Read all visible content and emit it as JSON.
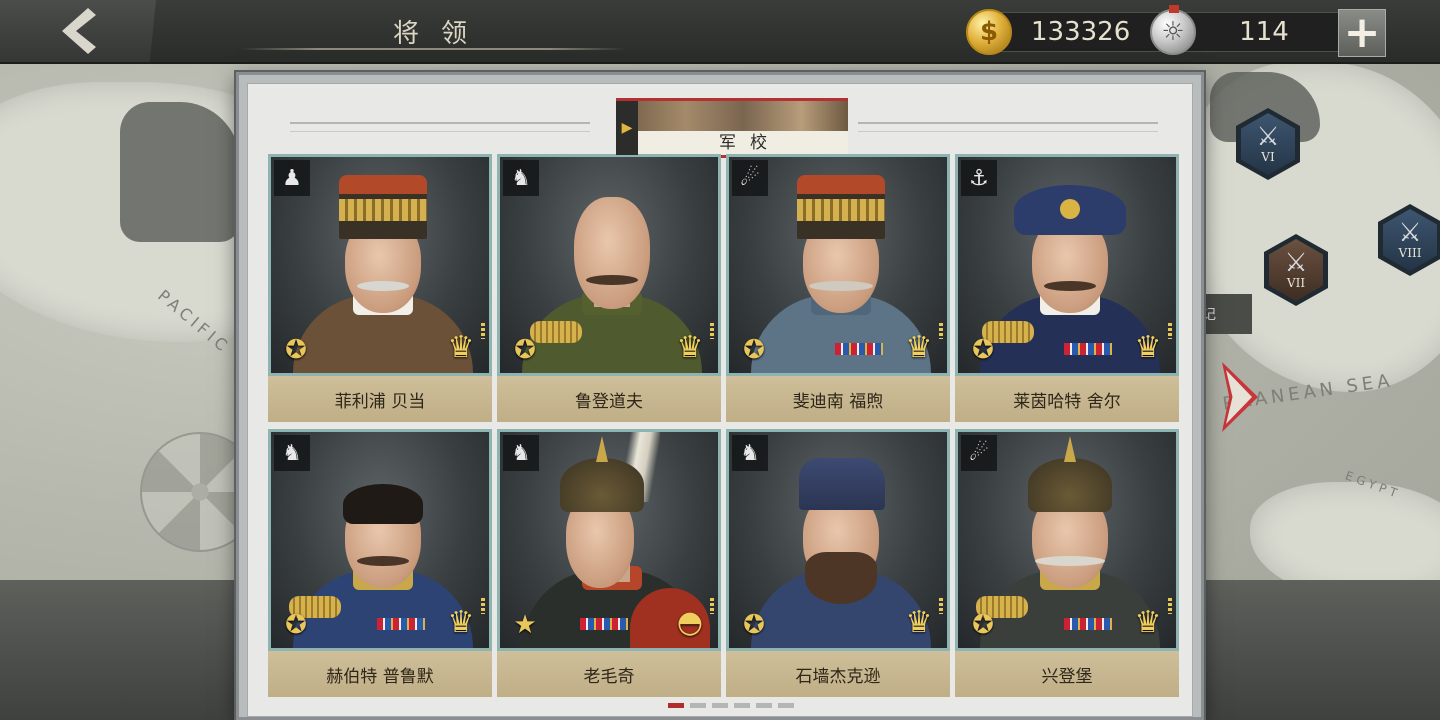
{
  "header": {
    "title": "将领",
    "gold": "133326",
    "silver": "114"
  },
  "map_labels": {
    "pacific": "PACIFIC",
    "mediterranean": "RRANEAN SEA",
    "egypt": "EGYPT",
    "side_chip": "记"
  },
  "hex_badges": [
    {
      "label": "VI",
      "color": "blue"
    },
    {
      "label": "VII",
      "color": "brown"
    },
    {
      "label": "VIII",
      "color": "blue"
    }
  ],
  "section": {
    "label": "军校"
  },
  "generals": [
    {
      "name": "菲利浦 贝当",
      "class_icon": "infantry-icon",
      "rank": "star-badge-icon"
    },
    {
      "name": "鲁登道夫",
      "class_icon": "cavalry-icon",
      "rank": "star-badge-icon"
    },
    {
      "name": "斐迪南 福煦",
      "class_icon": "artillery-icon",
      "rank": "star-badge-icon"
    },
    {
      "name": "莱茵哈特 舍尔",
      "class_icon": "navy-icon",
      "rank": "star-badge-icon"
    },
    {
      "name": "赫伯特 普鲁默",
      "class_icon": "cavalry-icon",
      "rank": "star-badge-icon"
    },
    {
      "name": "老毛奇",
      "class_icon": "cavalry-icon",
      "rank": "single-star-icon"
    },
    {
      "name": "石墙杰克逊",
      "class_icon": "cavalry-icon",
      "rank": "star-badge-icon"
    },
    {
      "name": "兴登堡",
      "class_icon": "artillery-icon",
      "rank": "star-badge-icon"
    }
  ],
  "pager": {
    "pages": 6,
    "current": 1
  },
  "colors": {
    "accent_red": "#b22c2c",
    "name_bar": "#c8b890",
    "portrait_border": "#8eb4b2"
  }
}
